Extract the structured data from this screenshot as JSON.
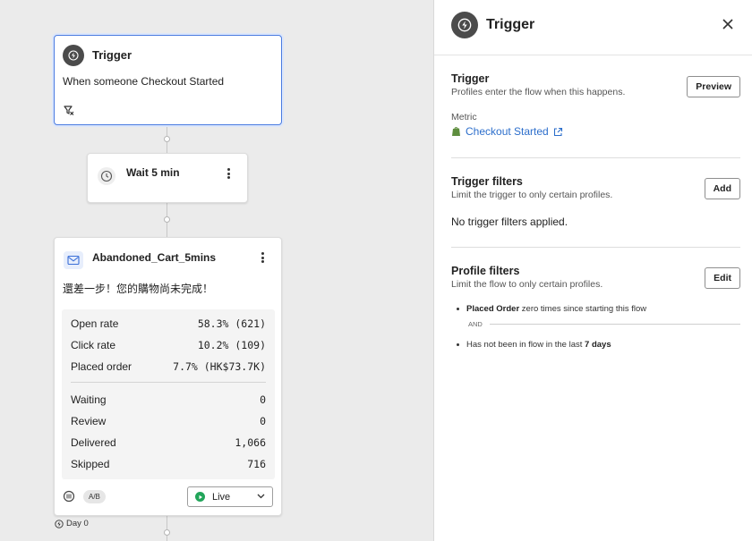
{
  "canvas": {
    "trigger_card": {
      "title": "Trigger",
      "description": "When someone Checkout Started",
      "icon": "lightning-icon",
      "filter_icon": "filter-off-icon"
    },
    "wait_card": {
      "title": "Wait 5 min",
      "icon": "clock-icon"
    },
    "email_card": {
      "title": "Abandoned_Cart_5mins",
      "subject": "還差一步！您的購物尚未完成！",
      "icon": "mail-icon",
      "stats_primary": [
        {
          "label": "Open rate",
          "value": "58.3% (621)"
        },
        {
          "label": "Click rate",
          "value": "10.2% (109)"
        },
        {
          "label": "Placed order",
          "value": "7.7% (HK$73.7K)"
        }
      ],
      "stats_secondary": [
        {
          "label": "Waiting",
          "value": "0"
        },
        {
          "label": "Review",
          "value": "0"
        },
        {
          "label": "Delivered",
          "value": "1,066"
        },
        {
          "label": "Skipped",
          "value": "716"
        }
      ],
      "ab_label": "A/B",
      "status": "Live"
    },
    "day_label": "Day 0"
  },
  "panel": {
    "title": "Trigger",
    "trigger_section": {
      "title": "Trigger",
      "subtitle": "Profiles enter the flow when this happens.",
      "button": "Preview",
      "metric_label": "Metric",
      "metric_value": "Checkout Started"
    },
    "trigger_filters": {
      "title": "Trigger filters",
      "subtitle": "Limit the trigger to only certain profiles.",
      "button": "Add",
      "empty_text": "No trigger filters applied."
    },
    "profile_filters": {
      "title": "Profile filters",
      "subtitle": "Limit the flow to only certain profiles.",
      "button": "Edit",
      "condition1_bold": "Placed Order",
      "condition1_rest": "zero times since starting this flow",
      "and_label": "AND",
      "condition2_text": "Has not been in flow in the last",
      "condition2_bold": "7 days"
    }
  },
  "colors": {
    "accent": "#4a7be0",
    "link": "#2c6ecb",
    "live": "#22a55a",
    "canvas_bg": "#ebebeb"
  }
}
